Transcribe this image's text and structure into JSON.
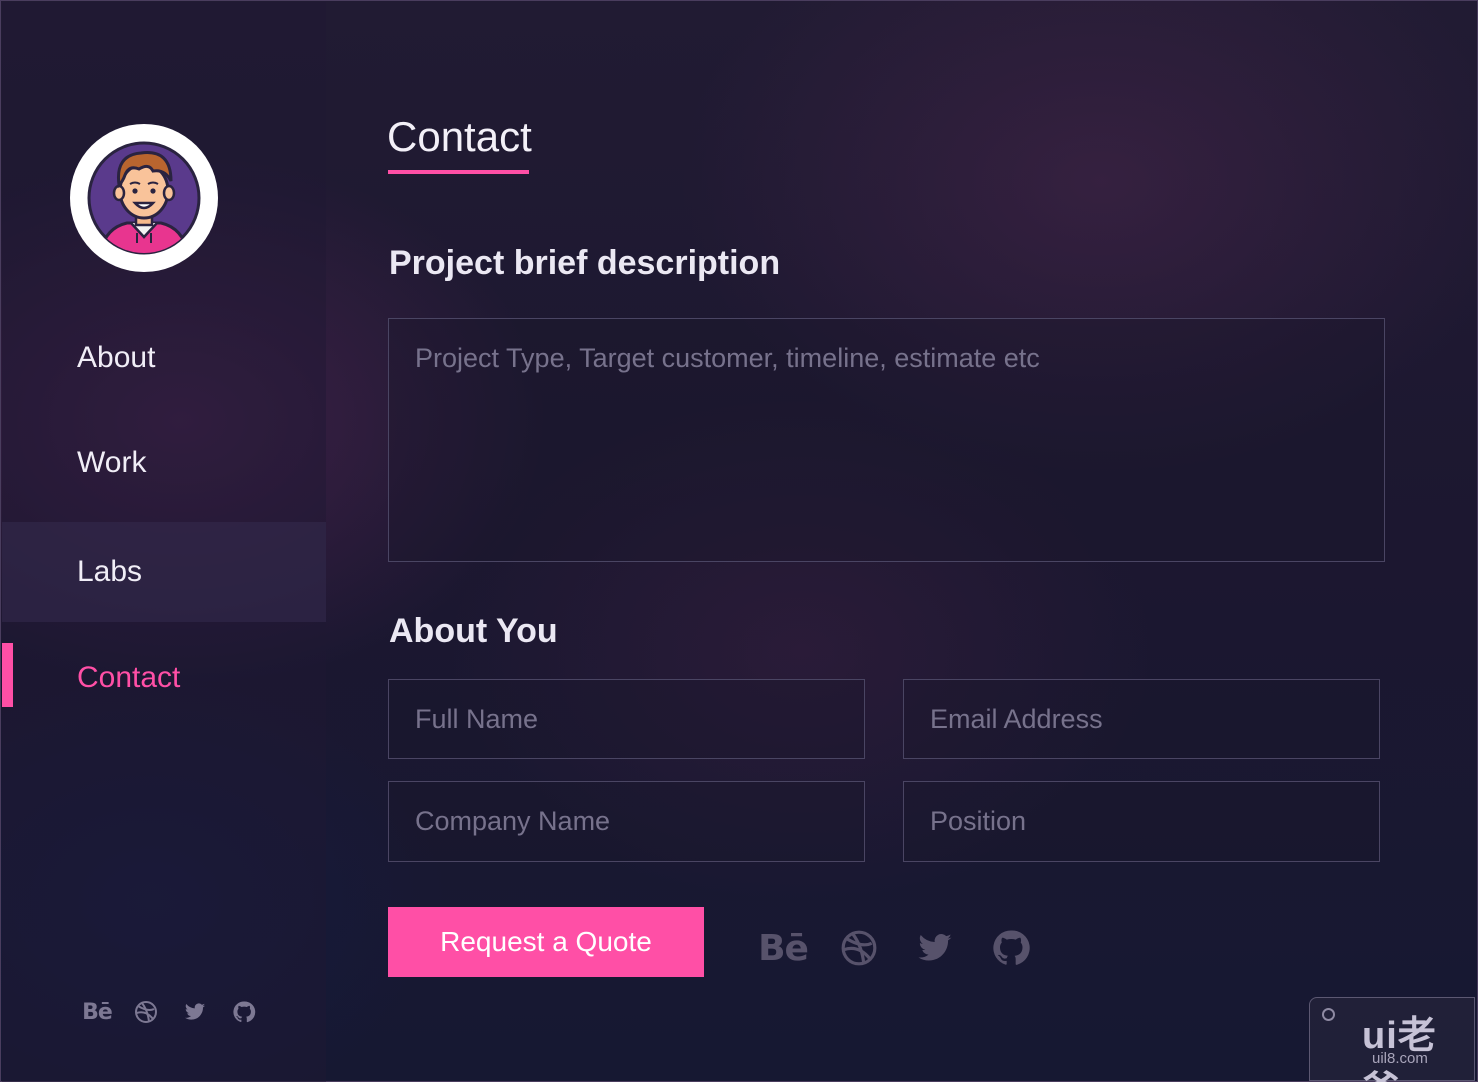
{
  "colors": {
    "accent": "#ff4fa6",
    "background": "#1b1833",
    "text": "#f1eef7",
    "placeholder": "#77728c",
    "field_border": "#4a4563"
  },
  "sidebar": {
    "avatar_icon": "avatar-illustration",
    "nav": [
      {
        "label": "About"
      },
      {
        "label": "Work"
      },
      {
        "label": "Labs"
      },
      {
        "label": "Contact"
      }
    ],
    "active_item": "Contact",
    "hovered_item": "Labs",
    "social_icons": [
      "behance-icon",
      "dribbble-icon",
      "twitter-icon",
      "github-icon"
    ],
    "behance_text": "Bē"
  },
  "main": {
    "title": "Contact",
    "project_section": {
      "heading": "Project brief description",
      "description_placeholder": "Project Type, Target customer, timeline, estimate etc"
    },
    "about_section": {
      "heading": "About You",
      "full_name_placeholder": "Full Name",
      "email_placeholder": "Email Address",
      "company_placeholder": "Company Name",
      "position_placeholder": "Position"
    },
    "submit_label": "Request a Quote",
    "social_icons": [
      "behance-icon",
      "dribbble-icon",
      "twitter-icon",
      "github-icon"
    ],
    "behance_text": "Bē"
  },
  "watermark": {
    "main": "ui老爸",
    "sub": "uil8.com"
  }
}
